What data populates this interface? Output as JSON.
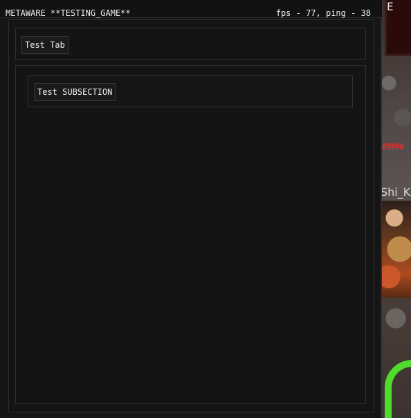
{
  "window": {
    "title": "METAWARE **TESTING_GAME**",
    "stats": "fps - 77, ping - 38"
  },
  "tabs": {
    "items": [
      {
        "label": "Test Tab"
      }
    ]
  },
  "panel": {
    "subsection": {
      "label": "Test SUBSECTION"
    }
  },
  "game_overlay": {
    "corner_letter": "E",
    "name_fragment": "Shi_K",
    "hash_fragment": "#####",
    "colors": {
      "accent_red": "#ff2a2a",
      "accent_green": "#4fdc2a"
    }
  }
}
